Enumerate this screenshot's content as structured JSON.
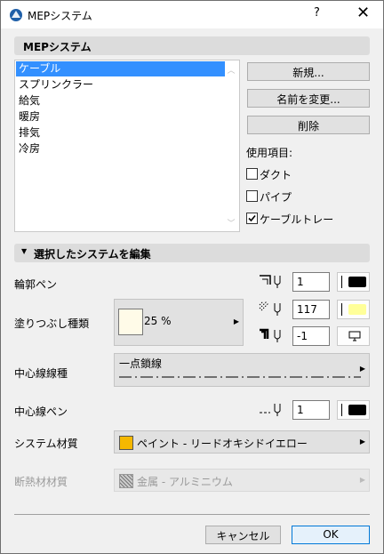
{
  "window": {
    "title": "MEPシステム",
    "help": "?",
    "close": "✕"
  },
  "mep_section": {
    "title": "MEPシステム"
  },
  "systems": {
    "items": [
      "ケーブル",
      "スプリンクラー",
      "給気",
      "暖房",
      "排気",
      "冷房"
    ],
    "selected": 0
  },
  "buttons": {
    "new": "新規...",
    "rename": "名前を変更...",
    "delete": "削除",
    "cancel": "キャンセル",
    "ok": "OK"
  },
  "usage": {
    "title": "使用項目:",
    "duct": {
      "label": "ダクト",
      "checked": false
    },
    "pipe": {
      "label": "パイプ",
      "checked": false
    },
    "cable_tray": {
      "label": "ケーブルトレー",
      "checked": true
    }
  },
  "edit_section": {
    "title": "選択したシステムを編集"
  },
  "contour_pen": {
    "label": "輪郭ペン",
    "value": "1",
    "color": "#000000"
  },
  "fill": {
    "label": "塗りつぶし種類",
    "percent": "25 %",
    "swatch_color": "#fffbe8",
    "fg_pen_value": "117",
    "fg_pen_color": "#ffff99",
    "bg_pen_value": "-1"
  },
  "centerline_type": {
    "label": "中心線線種",
    "value": "一点鎖線"
  },
  "centerline_pen": {
    "label": "中心線ペン",
    "value": "1",
    "color": "#000000"
  },
  "system_material": {
    "label": "システム材質",
    "value": "ペイント - リードオキシドイエロー",
    "color": "#f5b800"
  },
  "insulation_material": {
    "label": "断熱材材質",
    "value": "金属 - アルミニウム"
  }
}
